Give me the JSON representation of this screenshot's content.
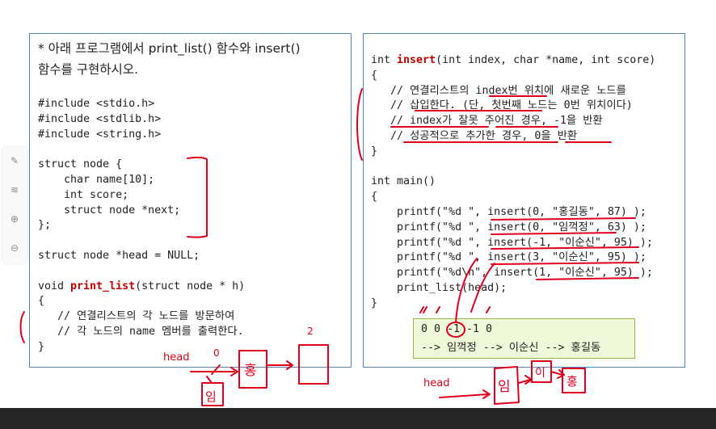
{
  "left": {
    "title_lines": [
      "* 아래 프로그램에서 print_list() 함수와 insert()",
      "함수를 구현하시오."
    ],
    "code_lines": [
      "#include <stdio.h>",
      "#include <stdlib.h>",
      "#include <string.h>",
      "",
      "struct node {",
      "    char name[10];",
      "    int score;",
      "    struct node *next;",
      "};",
      "",
      "struct node *head = NULL;",
      "",
      "void ",
      "{",
      "   // 연결리스트의 각 노드를 방문하여",
      "   // 각 노드의 name 멤버를 출력한다.",
      "}"
    ],
    "func_name": "print_list",
    "func_args": "(struct node * h)"
  },
  "right": {
    "sig_prefix": "int ",
    "func_name": "insert",
    "sig_args": "(int index, char *name, int score)",
    "code_lines": [
      "{",
      "   // 연결리스트의 index번 위치에 새로운 노드를",
      "   // 삽입한다. (단, 첫번째 노드는 0번 위치이다)",
      "   // index가 잘못 주어진 경우, -1을 반환",
      "   // 성공적으로 추가한 경우, 0을 반환",
      "}",
      "",
      "int main()",
      "{",
      "    printf(\"%d \", insert(0, \"홍길동\", 87) );",
      "    printf(\"%d \", insert(0, \"임꺽정\", 63) );",
      "    printf(\"%d \", insert(-1, \"이순신\", 95) );",
      "    printf(\"%d \", insert(3, \"이순신\", 95) );",
      "    printf(\"%d\\n\", insert(1, \"이순신\", 95) );",
      "    print_list(head);",
      "}"
    ]
  },
  "output": {
    "line1": "0 0 -1 -1 0",
    "line2": "--> 임꺽정 --> 이순신 --> 홍길동"
  },
  "annotations": {
    "head_left": "head",
    "head_right": "head",
    "zero_label": "0",
    "two_label": "2",
    "node_hong": "홍",
    "node_im": "임",
    "node_lee": "이",
    "node_hong2": "홍"
  },
  "tools": [
    "pen-icon",
    "highlighter-icon",
    "zoom-in-icon",
    "zoom-out-icon"
  ],
  "colors": {
    "panel_border": "#4f81bd",
    "output_bg": "#eef7d8",
    "ink": "#e0001b",
    "keyword": "#c00000"
  }
}
